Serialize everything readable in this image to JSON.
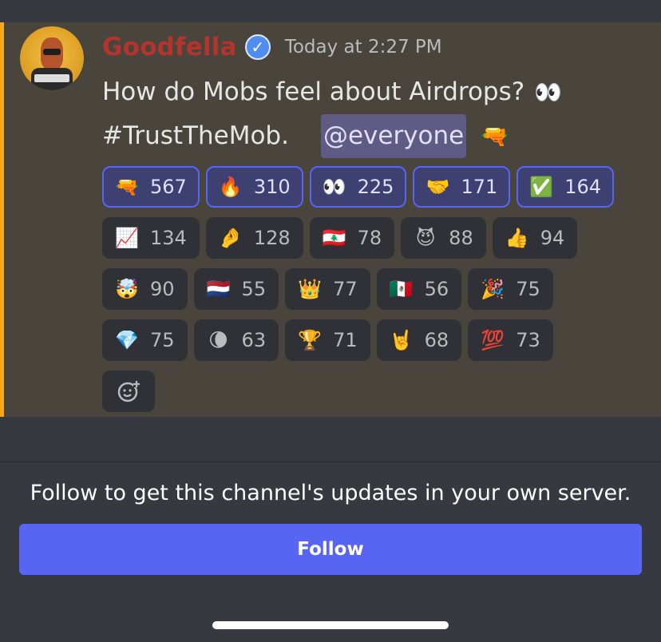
{
  "message": {
    "author": "Goodfella",
    "verified_glyph": "✓",
    "timestamp": "Today at 2:27 PM",
    "line1": "How do Mobs feel about Airdrops?",
    "line1_emoji": "👀",
    "line2": "#TrustTheMob.",
    "mention": "@everyone",
    "line2_emoji": "🔫",
    "accent_color": "#faa61a",
    "username_color": "#b3342c"
  },
  "reactions": [
    [
      {
        "emoji": "🔫",
        "count": "567",
        "me": true
      },
      {
        "emoji": "🔥",
        "count": "310",
        "me": true
      },
      {
        "emoji": "👀",
        "count": "225",
        "me": true
      },
      {
        "emoji": "🤝",
        "count": "171",
        "me": true
      },
      {
        "emoji": "✅",
        "count": "164",
        "me": true
      }
    ],
    [
      {
        "emoji": "📈",
        "count": "134",
        "me": false
      },
      {
        "emoji": "🤌",
        "count": "128",
        "me": false
      },
      {
        "emoji": "🇱🇧",
        "count": "78",
        "me": false
      },
      {
        "emoji": "😈",
        "count": "88",
        "me": false
      },
      {
        "emoji": "👍",
        "count": "94",
        "me": false
      }
    ],
    [
      {
        "emoji": "🤯",
        "count": "90",
        "me": false
      },
      {
        "emoji": "🇳🇱",
        "count": "55",
        "me": false
      },
      {
        "emoji": "👑",
        "count": "77",
        "me": false
      },
      {
        "emoji": "🇲🇽",
        "count": "56",
        "me": false
      },
      {
        "emoji": "🎉",
        "count": "75",
        "me": false
      }
    ],
    [
      {
        "emoji": "💎",
        "count": "75",
        "me": false
      },
      {
        "emoji": "🌘",
        "count": "63",
        "me": false
      },
      {
        "emoji": "🏆",
        "count": "71",
        "me": false
      },
      {
        "emoji": "🤘",
        "count": "68",
        "me": false
      },
      {
        "emoji": "💯",
        "count": "73",
        "me": false
      }
    ]
  ],
  "footer": {
    "follow_prompt": "Follow to get this channel's updates in your own server.",
    "follow_label": "Follow",
    "button_color": "#5865f2"
  }
}
